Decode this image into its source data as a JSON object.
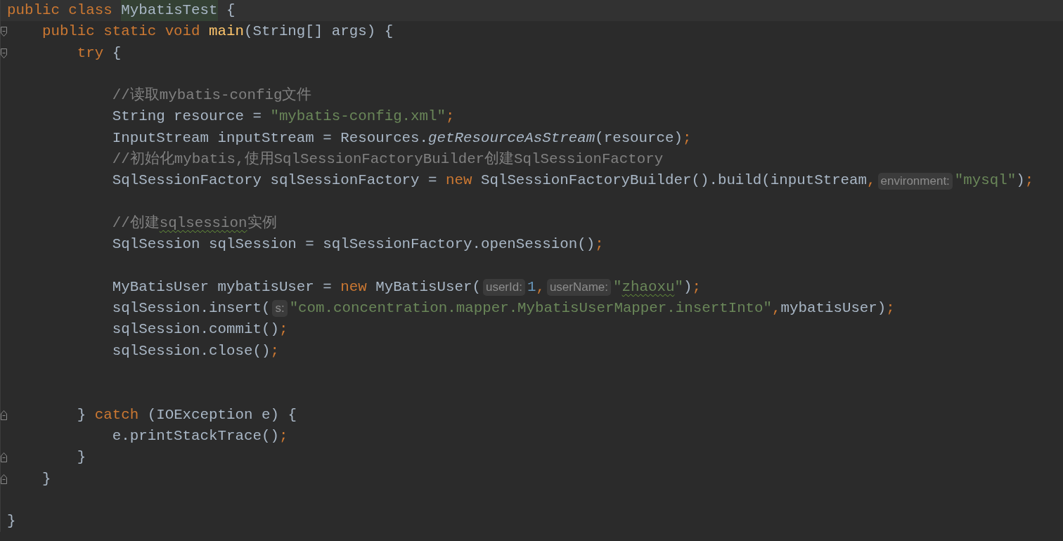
{
  "editor": {
    "lines": [
      {
        "kind": "code",
        "current": true,
        "tokens": [
          {
            "kind": "keyword",
            "text": "public class "
          },
          {
            "kind": "plain",
            "text": "MybatisTest",
            "highlighted": true
          },
          {
            "kind": "plain",
            "text": " {"
          }
        ]
      },
      {
        "kind": "code",
        "fold_start": true,
        "tokens": [
          {
            "kind": "keyword",
            "text": "    public static void "
          },
          {
            "kind": "decl",
            "text": "main"
          },
          {
            "kind": "plain",
            "text": "(String[] args) {"
          }
        ]
      },
      {
        "kind": "code",
        "fold_start": true,
        "tokens": [
          {
            "kind": "keyword",
            "text": "        try "
          },
          {
            "kind": "plain",
            "text": "{"
          }
        ]
      },
      {
        "kind": "blank"
      },
      {
        "kind": "code",
        "tokens": [
          {
            "kind": "comment",
            "text": "            //读取mybatis-config文件"
          }
        ]
      },
      {
        "kind": "code",
        "tokens": [
          {
            "kind": "plain",
            "text": "            String resource = "
          },
          {
            "kind": "string",
            "text": "\"mybatis-config.xml\""
          },
          {
            "kind": "punct",
            "text": ";"
          }
        ]
      },
      {
        "kind": "code",
        "tokens": [
          {
            "kind": "plain",
            "text": "            InputStream inputStream = Resources."
          },
          {
            "kind": "static",
            "text": "getResourceAsStream"
          },
          {
            "kind": "plain",
            "text": "(resource)"
          },
          {
            "kind": "punct",
            "text": ";"
          }
        ]
      },
      {
        "kind": "code",
        "tokens": [
          {
            "kind": "comment",
            "text": "            //初始化mybatis,使用SqlSessionFactoryBuilder创建SqlSessionFactory"
          }
        ]
      },
      {
        "kind": "code",
        "tokens": [
          {
            "kind": "plain",
            "text": "            SqlSessionFactory sqlSessionFactory = "
          },
          {
            "kind": "keyword",
            "text": "new "
          },
          {
            "kind": "plain",
            "text": "SqlSessionFactoryBuilder().build(inputStream"
          },
          {
            "kind": "punct",
            "text": ","
          },
          {
            "kind": "hint",
            "text": "environment:"
          },
          {
            "kind": "string",
            "text": "\"mysql\""
          },
          {
            "kind": "plain",
            "text": ")"
          },
          {
            "kind": "punct",
            "text": ";"
          }
        ]
      },
      {
        "kind": "blank"
      },
      {
        "kind": "code",
        "tokens": [
          {
            "kind": "comment",
            "text": "            //创建"
          },
          {
            "kind": "comment",
            "text": "sqlsession",
            "typo": true
          },
          {
            "kind": "comment",
            "text": "实例"
          }
        ]
      },
      {
        "kind": "code",
        "tokens": [
          {
            "kind": "plain",
            "text": "            SqlSession sqlSession = sqlSessionFactory.openSession()"
          },
          {
            "kind": "punct",
            "text": ";"
          }
        ]
      },
      {
        "kind": "blank"
      },
      {
        "kind": "code",
        "tokens": [
          {
            "kind": "plain",
            "text": "            MyBatisUser mybatisUser = "
          },
          {
            "kind": "keyword",
            "text": "new "
          },
          {
            "kind": "plain",
            "text": "MyBatisUser("
          },
          {
            "kind": "hint",
            "text": "userId:"
          },
          {
            "kind": "number",
            "text": "1"
          },
          {
            "kind": "punct",
            "text": ","
          },
          {
            "kind": "hint",
            "text": "userName:"
          },
          {
            "kind": "string",
            "text": "\""
          },
          {
            "kind": "string",
            "text": "zhaoxu",
            "typo": true
          },
          {
            "kind": "string",
            "text": "\""
          },
          {
            "kind": "plain",
            "text": ")"
          },
          {
            "kind": "punct",
            "text": ";"
          }
        ]
      },
      {
        "kind": "code",
        "tokens": [
          {
            "kind": "plain",
            "text": "            sqlSession.insert("
          },
          {
            "kind": "hint",
            "text": "s:"
          },
          {
            "kind": "string",
            "text": "\"com.concentration.mapper.MybatisUserMapper.insertInto\""
          },
          {
            "kind": "punct",
            "text": ","
          },
          {
            "kind": "plain",
            "text": "mybatisUser)"
          },
          {
            "kind": "punct",
            "text": ";"
          }
        ]
      },
      {
        "kind": "code",
        "tokens": [
          {
            "kind": "plain",
            "text": "            sqlSession.commit()"
          },
          {
            "kind": "punct",
            "text": ";"
          }
        ]
      },
      {
        "kind": "code",
        "tokens": [
          {
            "kind": "plain",
            "text": "            sqlSession.close()"
          },
          {
            "kind": "punct",
            "text": ";"
          }
        ]
      },
      {
        "kind": "blank"
      },
      {
        "kind": "blank"
      },
      {
        "kind": "code",
        "fold_end": true,
        "tokens": [
          {
            "kind": "plain",
            "text": "        } "
          },
          {
            "kind": "keyword",
            "text": "catch "
          },
          {
            "kind": "plain",
            "text": "(IOException e) {"
          }
        ]
      },
      {
        "kind": "code",
        "tokens": [
          {
            "kind": "plain",
            "text": "            e.printStackTrace()"
          },
          {
            "kind": "punct",
            "text": ";"
          }
        ]
      },
      {
        "kind": "code",
        "fold_end": true,
        "tokens": [
          {
            "kind": "plain",
            "text": "        }"
          }
        ]
      },
      {
        "kind": "code",
        "fold_end": true,
        "tokens": [
          {
            "kind": "plain",
            "text": "    }"
          }
        ]
      },
      {
        "kind": "blank"
      },
      {
        "kind": "code",
        "tokens": [
          {
            "kind": "plain",
            "text": "}"
          }
        ]
      }
    ]
  }
}
